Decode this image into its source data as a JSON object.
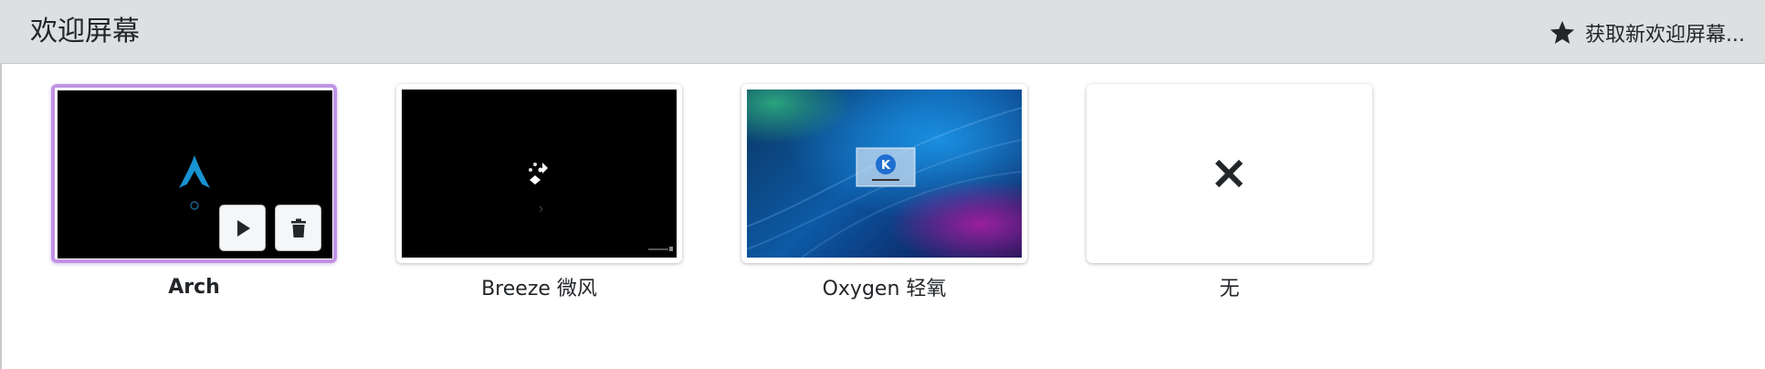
{
  "header": {
    "title": "欢迎屏幕",
    "get_new_label": "获取新欢迎屏幕...",
    "get_new_icon": "star-icon"
  },
  "themes": [
    {
      "name": "Arch",
      "selected": true,
      "preview": "arch-linux-logo-on-black"
    },
    {
      "name": "Breeze 微风",
      "selected": false,
      "preview": "breeze-spinner-on-black"
    },
    {
      "name": "Oxygen 轻氧",
      "selected": false,
      "preview": "oxygen-blue-wallpaper"
    },
    {
      "name": "无",
      "selected": false,
      "preview": "none-x-icon"
    }
  ],
  "selected_actions": {
    "preview_icon": "play-icon",
    "delete_icon": "trash-icon"
  },
  "colors": {
    "header_bg": "#dedfe1",
    "selection_border": "#c193e6",
    "arch_blue": "#1793d1"
  }
}
